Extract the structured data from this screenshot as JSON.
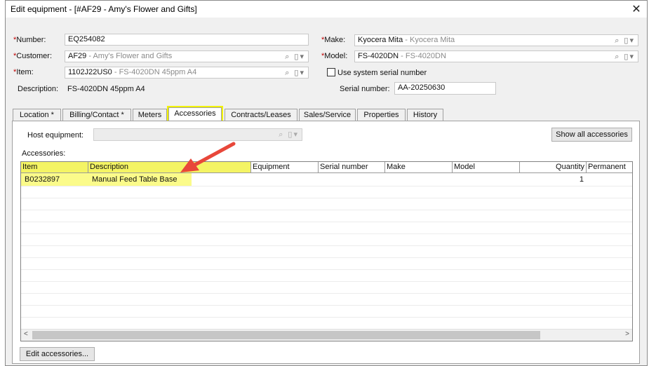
{
  "window": {
    "title": "Edit equipment - [#AF29 - Amy's Flower and Gifts]",
    "close_glyph": "✕"
  },
  "form": {
    "number": {
      "label": "Number:",
      "value": "EQ254082"
    },
    "customer": {
      "label": "Customer:",
      "code": "AF29",
      "name": " - Amy's Flower and Gifts"
    },
    "item": {
      "label": "Item:",
      "code": "1102J22US0",
      "name": " - FS-4020DN 45ppm A4"
    },
    "description": {
      "label": "Description:",
      "value": "FS-4020DN 45ppm A4"
    },
    "make": {
      "label": "Make:",
      "code": "Kyocera Mita",
      "name": " - Kyocera Mita"
    },
    "model": {
      "label": "Model:",
      "code": "FS-4020DN",
      "name": " - FS-4020DN"
    },
    "use_system_serial": {
      "label": "Use system serial number",
      "checked": false
    },
    "serial": {
      "label": "Serial number:",
      "value": "AA-20250630"
    },
    "required_mark": "*",
    "lookup_glyph": "⌕ ▯▾"
  },
  "tabs": [
    {
      "label": "Location *"
    },
    {
      "label": "Billing/Contact *"
    },
    {
      "label": "Meters"
    },
    {
      "label": "Accessories",
      "active": true
    },
    {
      "label": "Contracts/Leases"
    },
    {
      "label": "Sales/Service"
    },
    {
      "label": "Properties"
    },
    {
      "label": "History"
    }
  ],
  "accessories_tab": {
    "host_label": "Host equipment:",
    "show_all_label": "Show all accessories",
    "list_label": "Accessories:",
    "columns": [
      "Item",
      "Description",
      "Equipment",
      "Serial number",
      "Make",
      "Model",
      "Quantity",
      "Permanent"
    ],
    "rows": [
      {
        "item": "B0232897",
        "description": "Manual Feed Table Base",
        "equipment": "",
        "serial": "",
        "make": "",
        "model": "",
        "quantity": "1",
        "permanent": ""
      }
    ],
    "scroll_left": "<",
    "scroll_right": ">",
    "edit_label": "Edit accessories..."
  },
  "colors": {
    "highlight": "#f4f464",
    "arrow": "#e8473a",
    "required": "#c00000"
  }
}
